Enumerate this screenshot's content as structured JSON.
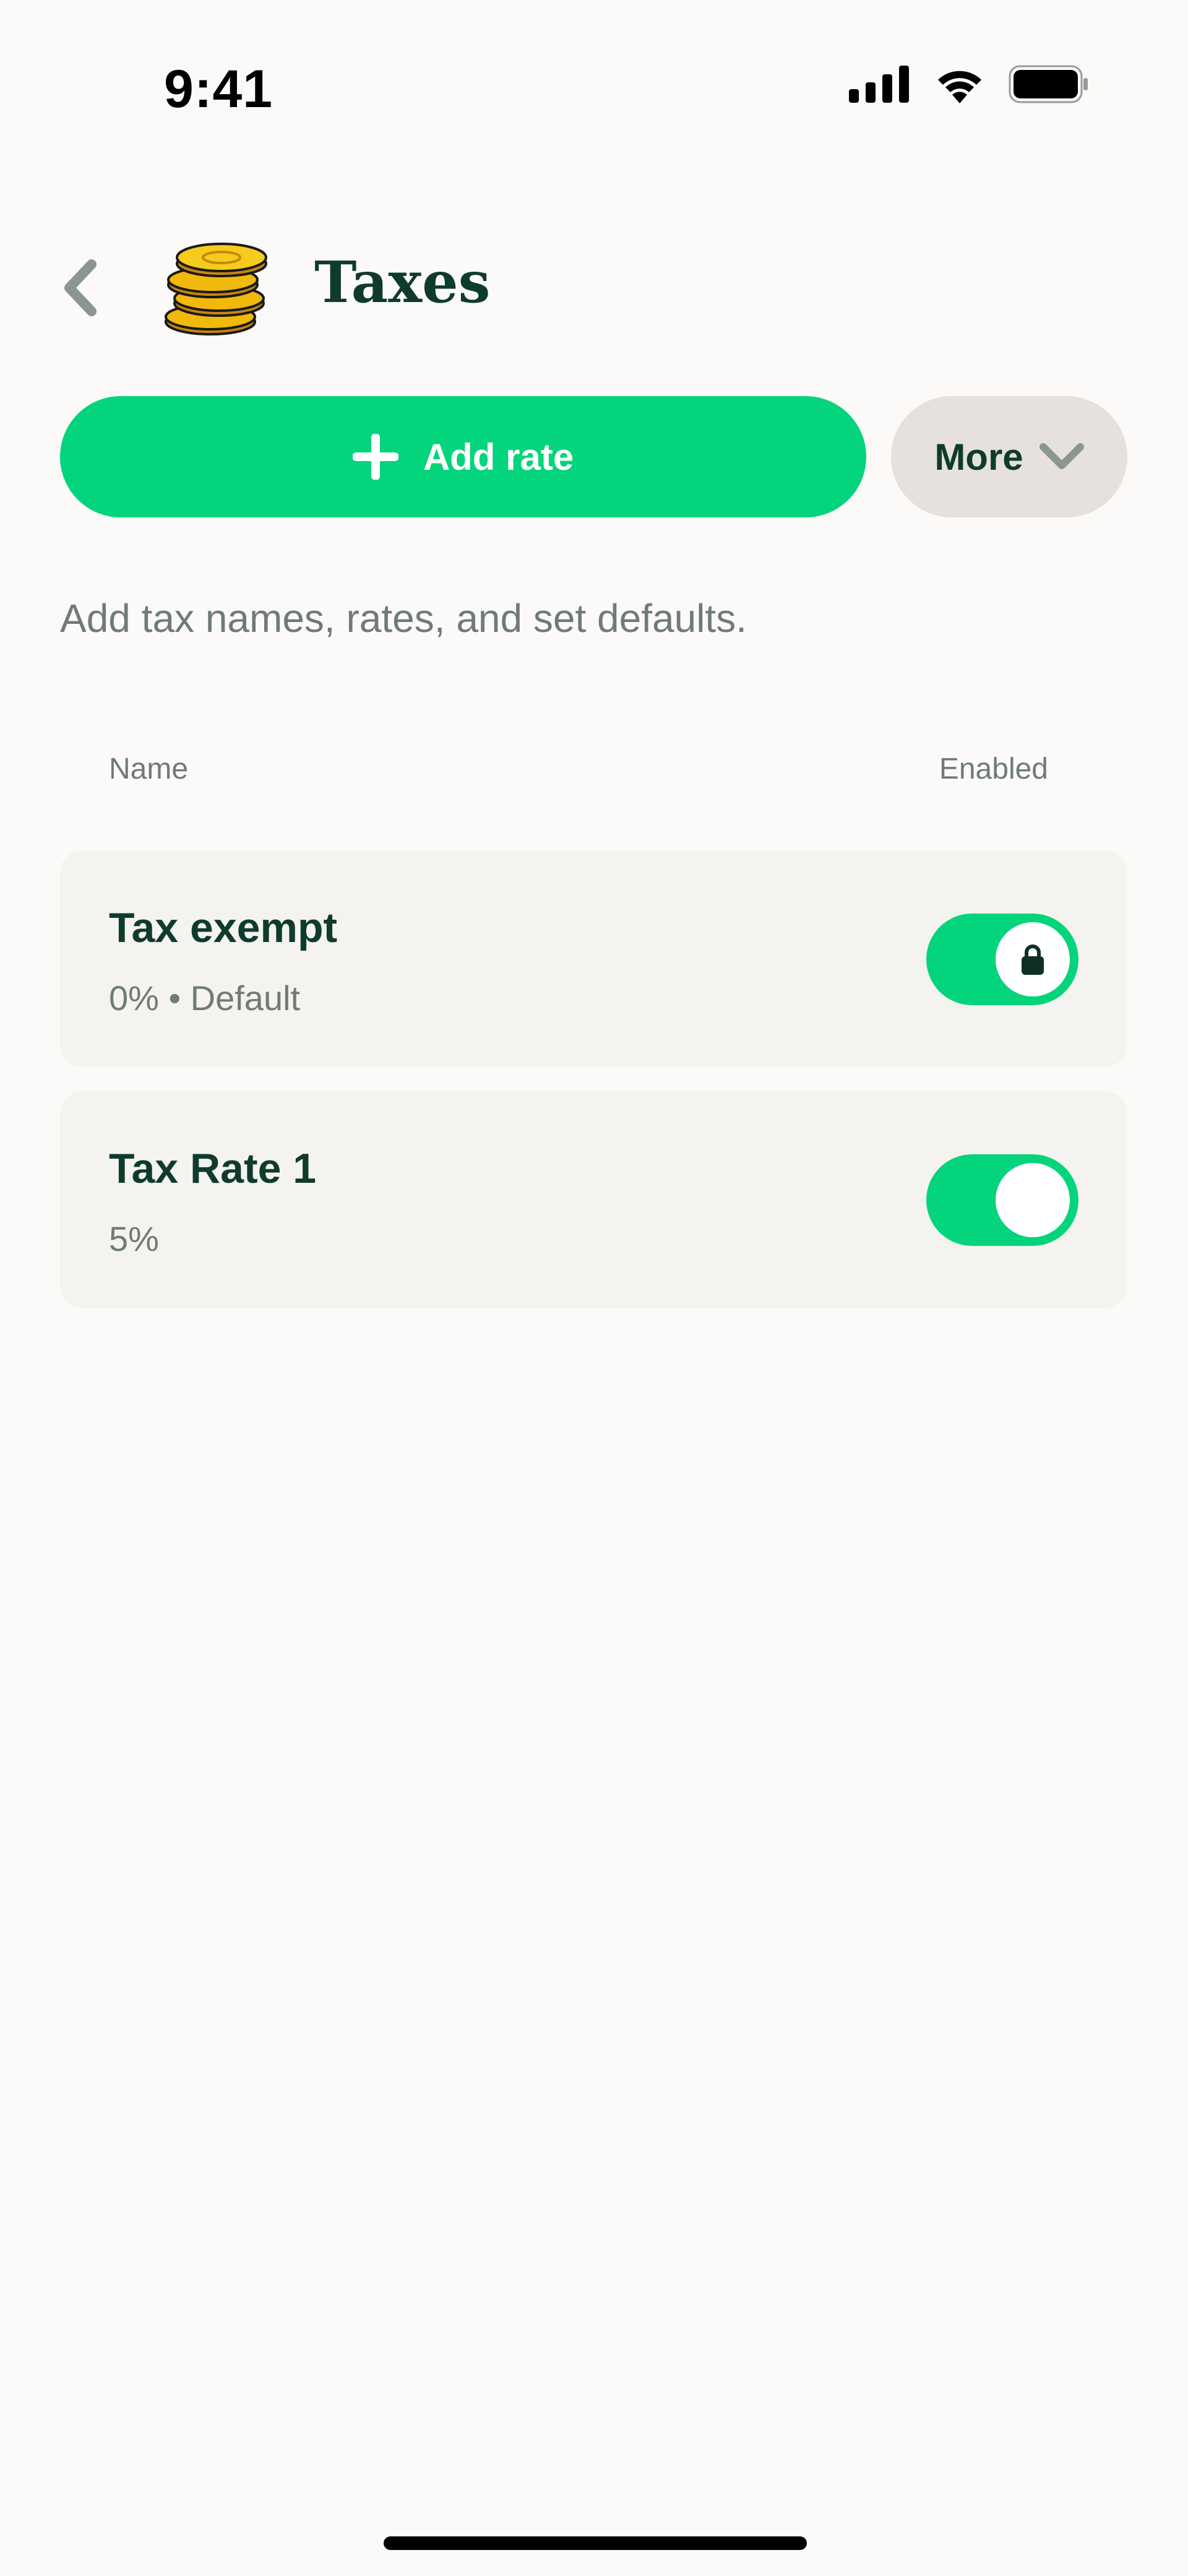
{
  "status_bar": {
    "time": "9:41",
    "icons": [
      "cellular-signal-icon",
      "wifi-icon",
      "battery-icon"
    ]
  },
  "header": {
    "back_icon": "chevron-left-icon",
    "logo_icon": "coins-icon",
    "title": "Taxes"
  },
  "actions": {
    "add_rate_label": "Add rate",
    "add_rate_icon": "plus-icon",
    "more_label": "More",
    "more_icon": "chevron-down-icon"
  },
  "description": "Add tax names, rates, and set defaults.",
  "table": {
    "columns": {
      "name": "Name",
      "enabled": "Enabled"
    },
    "rows": [
      {
        "name": "Tax exempt",
        "detail": "0% • Default",
        "enabled": true,
        "locked": true
      },
      {
        "name": "Tax Rate 1",
        "detail": "5%",
        "enabled": true,
        "locked": false
      }
    ]
  },
  "colors": {
    "accent": "#04d47c",
    "text_primary": "#0f3b2d",
    "text_secondary": "#6f7b76",
    "background": "#fbfaf8",
    "card": "#f5f3ef",
    "secondary_button": "#e6e1dc"
  }
}
